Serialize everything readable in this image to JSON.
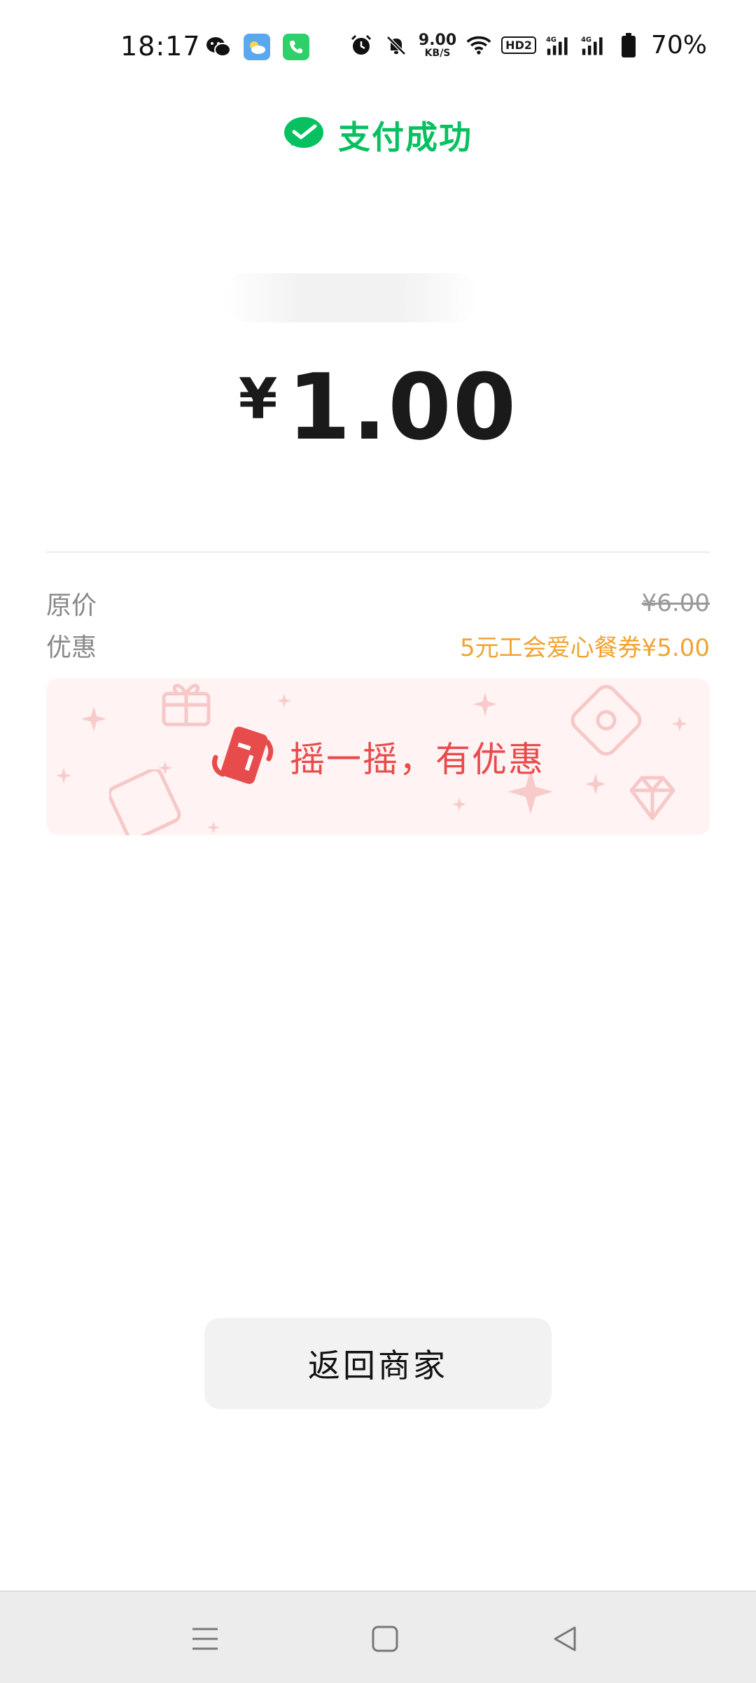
{
  "status_bar": {
    "time": "18:17",
    "left_icons": [
      "wechat-icon",
      "weather-app-icon",
      "phone-app-icon"
    ],
    "right_icons": [
      "alarm-icon",
      "mute-icon",
      "wifi-icon",
      "hd-icon",
      "signal-4g-icon",
      "signal-4g-icon",
      "battery-icon"
    ],
    "net_speed_value": "9.00",
    "net_speed_unit": "KB/S",
    "hd_label": "HD2",
    "battery_percent": "70%"
  },
  "header": {
    "icon": "wechat-pay-check-icon",
    "title": "支付成功"
  },
  "payment": {
    "currency": "¥",
    "amount": "1.00"
  },
  "details": {
    "original_label": "原价",
    "original_value": "¥6.00",
    "discount_label": "优惠",
    "discount_value": "5元工会爱心餐券¥5.00"
  },
  "promo": {
    "icon": "shake-phone-icon",
    "text": "摇一摇，有优惠"
  },
  "actions": {
    "back_label": "返回商家"
  },
  "nav": {
    "items": [
      "menu-icon",
      "home-icon",
      "back-icon"
    ]
  },
  "colors": {
    "brand_green": "#07c160",
    "discount_orange": "#f2a330",
    "promo_red": "#e84b4b",
    "promo_bg": "#fff3f3"
  }
}
